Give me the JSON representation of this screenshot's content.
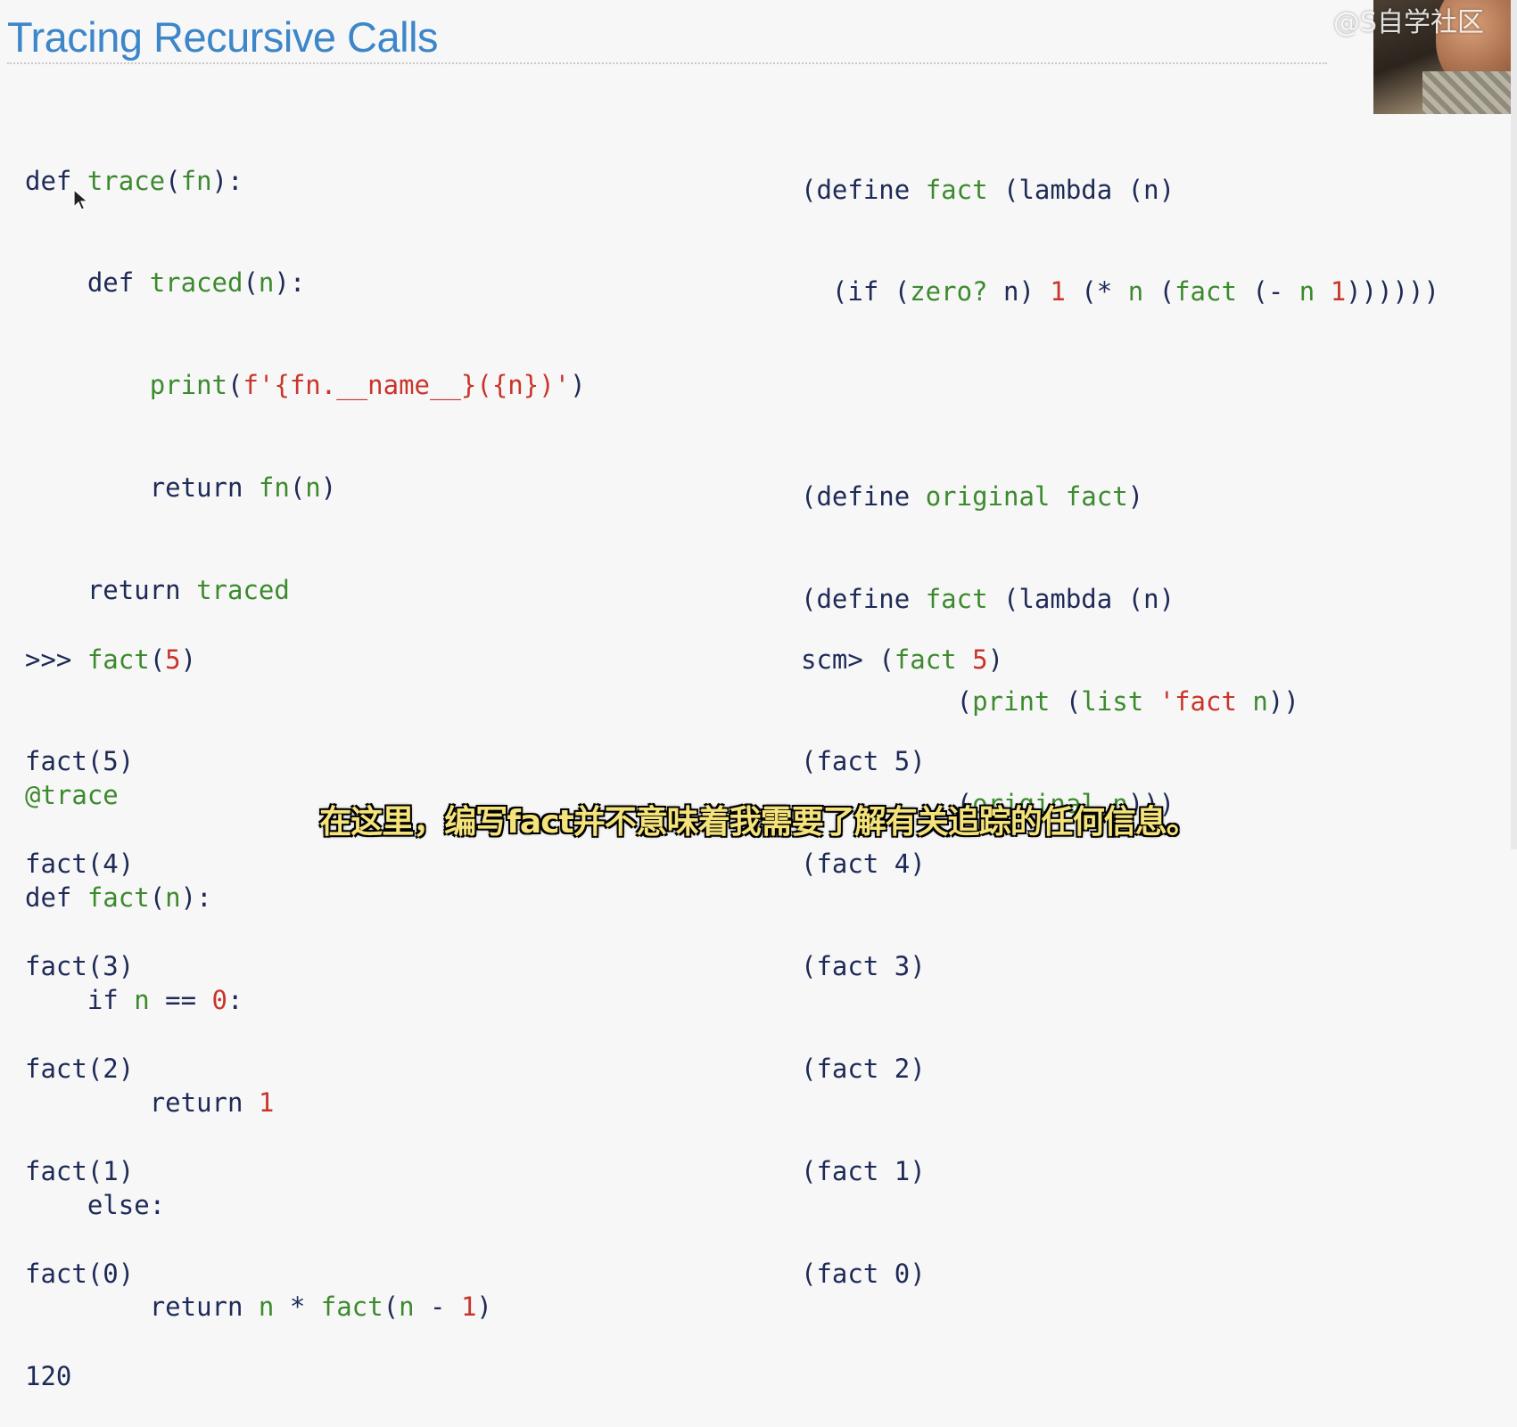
{
  "slide": {
    "title": "Tracing Recursive Calls"
  },
  "python_def": {
    "l1_def": "def ",
    "l1_name": "trace",
    "l1_open": "(",
    "l1_arg": "fn",
    "l1_close": "):",
    "l2_indent": "    ",
    "l2_def": "def ",
    "l2_name": "traced",
    "l2_open": "(",
    "l2_arg": "n",
    "l2_close": "):",
    "l3_indent": "        ",
    "l3_fn": "print",
    "l3_open": "(",
    "l3_str": "f'{fn.__name__}({n})'",
    "l3_close": ")",
    "l4_indent": "        ",
    "l4_ret": "return ",
    "l4_call": "fn",
    "l4_open": "(",
    "l4_arg": "n",
    "l4_close": ")",
    "l5_indent": "    ",
    "l5_ret": "return ",
    "l5_val": "traced",
    "l7_decorator": "@trace",
    "l8_def": "def ",
    "l8_name": "fact",
    "l8_open": "(",
    "l8_arg": "n",
    "l8_close": "):",
    "l9_indent": "    ",
    "l9_if": "if ",
    "l9_n": "n",
    "l9_eq": " == ",
    "l9_zero": "0",
    "l9_colon": ":",
    "l10_indent": "        ",
    "l10_ret": "return ",
    "l10_one": "1",
    "l11_indent": "    ",
    "l11_else": "else:",
    "l12_indent": "        ",
    "l12_ret": "return ",
    "l12_n": "n",
    "l12_mul": " * ",
    "l12_fact": "fact",
    "l12_open": "(",
    "l12_n2": "n",
    "l12_minus": " - ",
    "l12_one": "1",
    "l12_close": ")"
  },
  "scheme_def": {
    "l1_a": "(define ",
    "l1_b": "fact",
    "l1_c": " (lambda ",
    "l1_d": "(n)",
    "l2_a": "  (if (",
    "l2_b": "zero?",
    "l2_c": " n) ",
    "l2_d": "1",
    "l2_e": " (* ",
    "l2_f": "n",
    "l2_g": " (",
    "l2_h": "fact",
    "l2_i": " (- ",
    "l2_j": "n",
    "l2_k": " ",
    "l2_l": "1",
    "l2_m": "))))))",
    "l4_a": "(define ",
    "l4_b": "original fact",
    "l4_c": ")",
    "l5_a": "(define ",
    "l5_b": "fact",
    "l5_c": " (lambda ",
    "l5_d": "(n)",
    "l6_indent": "          ",
    "l6_a": "(",
    "l6_b": "print",
    "l6_c": " (",
    "l6_d": "list",
    "l6_e": " ",
    "l6_f": "'fact",
    "l6_g": " ",
    "l6_h": "n",
    "l6_i": "))",
    "l7_indent": "          ",
    "l7_a": "(",
    "l7_b": "original",
    "l7_c": " ",
    "l7_d": "n",
    "l7_e": ")))"
  },
  "python_session": {
    "prompt": ">>> ",
    "call": "fact",
    "open": "(",
    "arg": "5",
    "close": ")",
    "outputs": [
      "fact(5)",
      "fact(4)",
      "fact(3)",
      "fact(2)",
      "fact(1)",
      "fact(0)",
      "120"
    ]
  },
  "scheme_session": {
    "prompt": "scm> ",
    "open": "(",
    "call": "fact",
    "space": " ",
    "arg": "5",
    "close": ")",
    "outputs": [
      "(fact 5)",
      "(fact 4)",
      "(fact 3)",
      "(fact 2)",
      "(fact 1)",
      "(fact 0)"
    ]
  },
  "overlay": {
    "watermark": "@S自学社区",
    "subtitle": "在这里，编写fact并不意味着我需要了解有关追踪的任何信息。"
  },
  "colors": {
    "title": "#3d86c9",
    "code_default": "#1e2a57",
    "code_green": "#3c8a2e",
    "code_red": "#c9352b",
    "subtitle": "#f4e27a"
  }
}
